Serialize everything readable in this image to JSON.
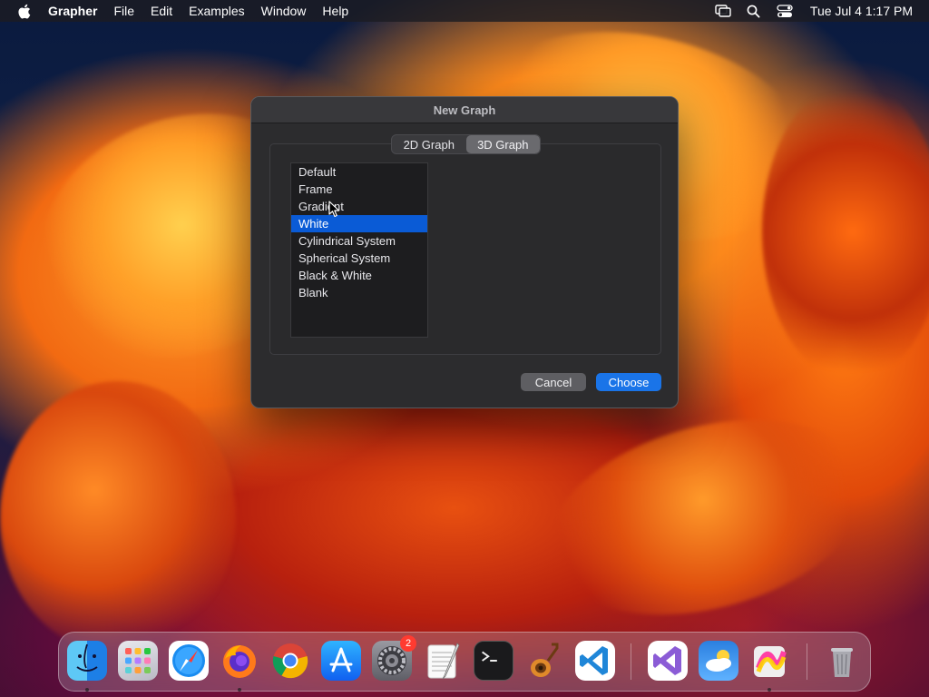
{
  "menubar": {
    "app_name": "Grapher",
    "menus": [
      "File",
      "Edit",
      "Examples",
      "Window",
      "Help"
    ],
    "clock": "Tue Jul 4  1:17 PM"
  },
  "dialog": {
    "title": "New Graph",
    "tabs": [
      {
        "label": "2D Graph",
        "active": false
      },
      {
        "label": "3D Graph",
        "active": true
      }
    ],
    "templates": [
      "Default",
      "Frame",
      "Gradient",
      "White",
      "Cylindrical System",
      "Spherical System",
      "Black & White",
      "Blank"
    ],
    "selected_template": "White",
    "cancel_label": "Cancel",
    "choose_label": "Choose"
  },
  "dock": {
    "apps": [
      "Finder",
      "Launchpad",
      "Safari",
      "Firefox",
      "Chrome",
      "App Store",
      "System Settings",
      "TextEdit",
      "Terminal",
      "GarageBand",
      "Visual Studio Code",
      "Visual Studio",
      "Weather",
      "Grapher",
      "Trash"
    ],
    "system_settings_badge": "2"
  },
  "colors": {
    "selection": "#0a5bd6",
    "primary_button": "#1a74e8"
  }
}
